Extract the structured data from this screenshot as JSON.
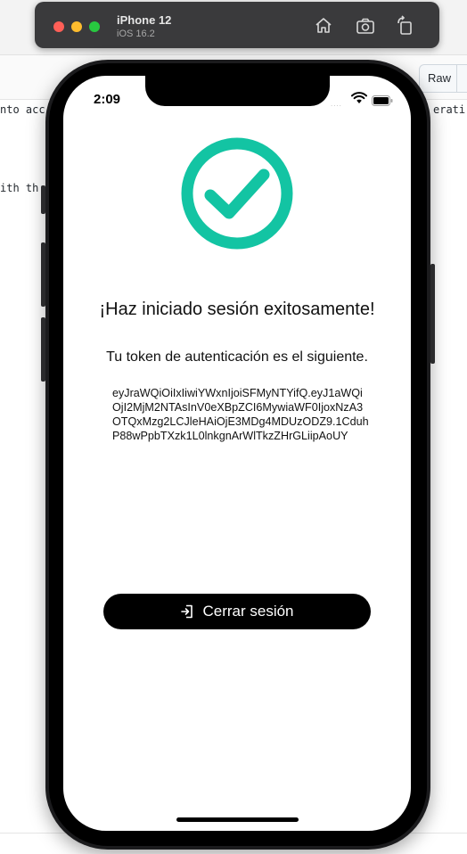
{
  "simulator": {
    "device_name": "iPhone 12",
    "os_version": "iOS 16.2",
    "home_icon": "home-icon",
    "screenshot_icon": "camera-icon",
    "rotate_icon": "rotate-icon"
  },
  "background_editor": {
    "raw_button": "Raw",
    "code_line_1_left": "nto acc",
    "code_line_1_right": "erati",
    "code_line_2_left": "ith th"
  },
  "status_bar": {
    "time": "2:09",
    "signal_indicator": "....",
    "wifi_icon": "wifi-icon",
    "battery_icon": "battery-icon"
  },
  "app": {
    "success_icon": "check-circle-icon",
    "accent_color": "#13c4a3",
    "title": "¡Haz iniciado sesión exitosamente!",
    "subtitle": "Tu token de autenticación es el siguiente.",
    "token": "eyJraWQiOiIxIiwiYWxnIjoiSFMyNTYifQ.eyJ1aWQiOjI2MjM2NTAsInV0eXBpZCI6MywiaWF0IjoxNzA3OTQxMzg2LCJleHAiOjE3MDg4MDUzODZ9.1CduhP88wPpbTXzk1L0lnkgnArWlTkzZHrGLiipAoUY",
    "logout_button": {
      "label": "Cerrar sesión",
      "icon": "sign-in-icon"
    }
  }
}
